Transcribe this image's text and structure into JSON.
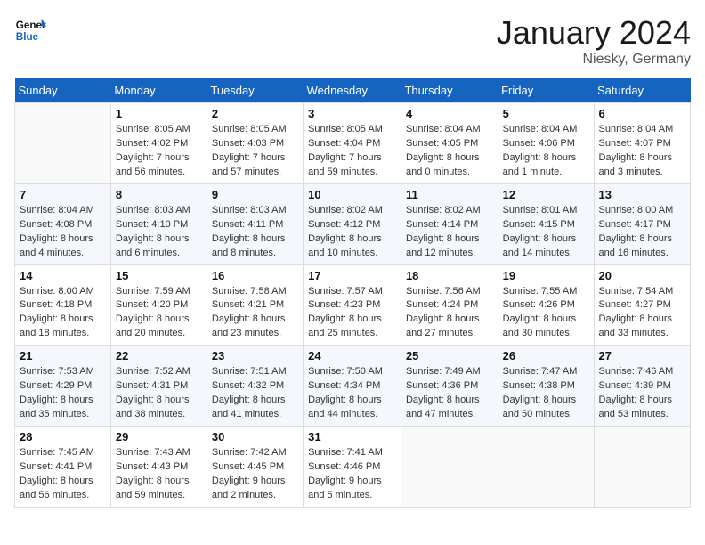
{
  "header": {
    "logo_general": "General",
    "logo_blue": "Blue",
    "month": "January 2024",
    "location": "Niesky, Germany"
  },
  "days_of_week": [
    "Sunday",
    "Monday",
    "Tuesday",
    "Wednesday",
    "Thursday",
    "Friday",
    "Saturday"
  ],
  "weeks": [
    [
      {
        "day": "",
        "empty": true
      },
      {
        "day": "1",
        "sunrise": "8:05 AM",
        "sunset": "4:02 PM",
        "daylight": "7 hours and 56 minutes."
      },
      {
        "day": "2",
        "sunrise": "8:05 AM",
        "sunset": "4:03 PM",
        "daylight": "7 hours and 57 minutes."
      },
      {
        "day": "3",
        "sunrise": "8:05 AM",
        "sunset": "4:04 PM",
        "daylight": "7 hours and 59 minutes."
      },
      {
        "day": "4",
        "sunrise": "8:04 AM",
        "sunset": "4:05 PM",
        "daylight": "8 hours and 0 minutes."
      },
      {
        "day": "5",
        "sunrise": "8:04 AM",
        "sunset": "4:06 PM",
        "daylight": "8 hours and 1 minute."
      },
      {
        "day": "6",
        "sunrise": "8:04 AM",
        "sunset": "4:07 PM",
        "daylight": "8 hours and 3 minutes."
      }
    ],
    [
      {
        "day": "7",
        "sunrise": "8:04 AM",
        "sunset": "4:08 PM",
        "daylight": "8 hours and 4 minutes."
      },
      {
        "day": "8",
        "sunrise": "8:03 AM",
        "sunset": "4:10 PM",
        "daylight": "8 hours and 6 minutes."
      },
      {
        "day": "9",
        "sunrise": "8:03 AM",
        "sunset": "4:11 PM",
        "daylight": "8 hours and 8 minutes."
      },
      {
        "day": "10",
        "sunrise": "8:02 AM",
        "sunset": "4:12 PM",
        "daylight": "8 hours and 10 minutes."
      },
      {
        "day": "11",
        "sunrise": "8:02 AM",
        "sunset": "4:14 PM",
        "daylight": "8 hours and 12 minutes."
      },
      {
        "day": "12",
        "sunrise": "8:01 AM",
        "sunset": "4:15 PM",
        "daylight": "8 hours and 14 minutes."
      },
      {
        "day": "13",
        "sunrise": "8:00 AM",
        "sunset": "4:17 PM",
        "daylight": "8 hours and 16 minutes."
      }
    ],
    [
      {
        "day": "14",
        "sunrise": "8:00 AM",
        "sunset": "4:18 PM",
        "daylight": "8 hours and 18 minutes."
      },
      {
        "day": "15",
        "sunrise": "7:59 AM",
        "sunset": "4:20 PM",
        "daylight": "8 hours and 20 minutes."
      },
      {
        "day": "16",
        "sunrise": "7:58 AM",
        "sunset": "4:21 PM",
        "daylight": "8 hours and 23 minutes."
      },
      {
        "day": "17",
        "sunrise": "7:57 AM",
        "sunset": "4:23 PM",
        "daylight": "8 hours and 25 minutes."
      },
      {
        "day": "18",
        "sunrise": "7:56 AM",
        "sunset": "4:24 PM",
        "daylight": "8 hours and 27 minutes."
      },
      {
        "day": "19",
        "sunrise": "7:55 AM",
        "sunset": "4:26 PM",
        "daylight": "8 hours and 30 minutes."
      },
      {
        "day": "20",
        "sunrise": "7:54 AM",
        "sunset": "4:27 PM",
        "daylight": "8 hours and 33 minutes."
      }
    ],
    [
      {
        "day": "21",
        "sunrise": "7:53 AM",
        "sunset": "4:29 PM",
        "daylight": "8 hours and 35 minutes."
      },
      {
        "day": "22",
        "sunrise": "7:52 AM",
        "sunset": "4:31 PM",
        "daylight": "8 hours and 38 minutes."
      },
      {
        "day": "23",
        "sunrise": "7:51 AM",
        "sunset": "4:32 PM",
        "daylight": "8 hours and 41 minutes."
      },
      {
        "day": "24",
        "sunrise": "7:50 AM",
        "sunset": "4:34 PM",
        "daylight": "8 hours and 44 minutes."
      },
      {
        "day": "25",
        "sunrise": "7:49 AM",
        "sunset": "4:36 PM",
        "daylight": "8 hours and 47 minutes."
      },
      {
        "day": "26",
        "sunrise": "7:47 AM",
        "sunset": "4:38 PM",
        "daylight": "8 hours and 50 minutes."
      },
      {
        "day": "27",
        "sunrise": "7:46 AM",
        "sunset": "4:39 PM",
        "daylight": "8 hours and 53 minutes."
      }
    ],
    [
      {
        "day": "28",
        "sunrise": "7:45 AM",
        "sunset": "4:41 PM",
        "daylight": "8 hours and 56 minutes."
      },
      {
        "day": "29",
        "sunrise": "7:43 AM",
        "sunset": "4:43 PM",
        "daylight": "8 hours and 59 minutes."
      },
      {
        "day": "30",
        "sunrise": "7:42 AM",
        "sunset": "4:45 PM",
        "daylight": "9 hours and 2 minutes."
      },
      {
        "day": "31",
        "sunrise": "7:41 AM",
        "sunset": "4:46 PM",
        "daylight": "9 hours and 5 minutes."
      },
      {
        "day": "",
        "empty": true
      },
      {
        "day": "",
        "empty": true
      },
      {
        "day": "",
        "empty": true
      }
    ]
  ]
}
